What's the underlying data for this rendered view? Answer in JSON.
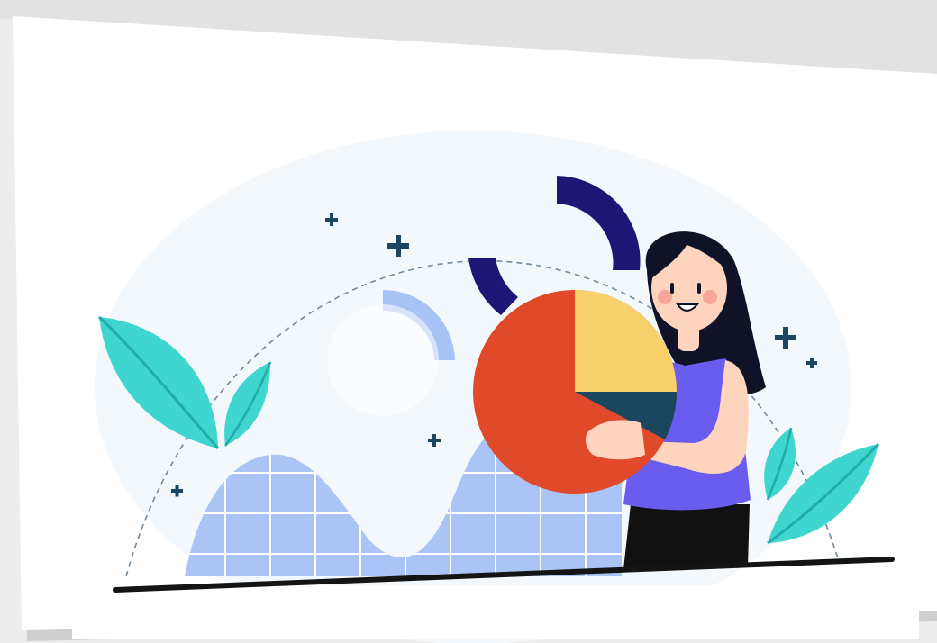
{
  "illustration": {
    "subject": "woman-holding-pie-chart",
    "icons": [
      "plus-icon",
      "leaf-icon",
      "pie-chart-icon"
    ],
    "colors": {
      "background": "#ededed",
      "card": "#ffffff",
      "halo": "#f3f8fc",
      "dashed_arc": "#6f8a9e",
      "grid_chart": "#a9c4f5",
      "grid_lines": "#ffffff",
      "dark_arc": "#1e1675",
      "light_arc": "#a7c2f5",
      "pie_red": "#e04a2b",
      "pie_yellow": "#f7d06b",
      "pie_navy": "#1b4660",
      "top_purple": "#6b5cf0",
      "pants": "#111111",
      "hair": "#101328",
      "skin": "#ffd4bf",
      "cheek": "#f59a8e",
      "leaf_teal": "#3fd6cf",
      "leaf_dark": "#22aca9",
      "sparkle": "#1b4660",
      "ground": "#141414"
    }
  }
}
